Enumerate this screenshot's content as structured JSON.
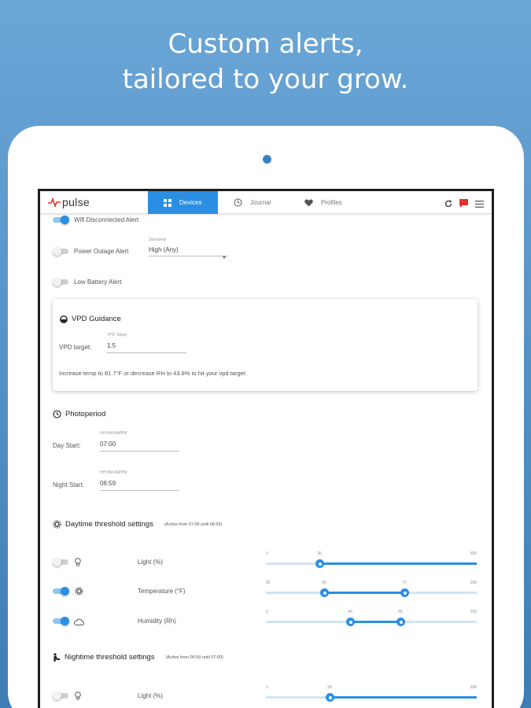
{
  "headline": {
    "line1": "Custom alerts,",
    "line2": "tailored to your grow."
  },
  "app": {
    "brand": "pulse",
    "tabs": [
      {
        "label": "Devices",
        "icon": "devices-grid-icon",
        "active": true
      },
      {
        "label": "Journal",
        "icon": "clock-icon",
        "active": false
      },
      {
        "label": "Profiles",
        "icon": "heart-icon",
        "active": false
      }
    ],
    "toolbar": {
      "refresh_icon": "refresh-icon",
      "alert_icon": "flag-alert-icon",
      "menu_icon": "hamburger-menu-icon"
    }
  },
  "alerts": {
    "wifi": {
      "label": "Wifi Disconnected Alert",
      "enabled": true
    },
    "power": {
      "label": "Power Outage Alert",
      "enabled": false,
      "sensitivity_label": "Sensitivity",
      "sensitivity_value": "High (Any)"
    },
    "battery": {
      "label": "Low Battery Alert",
      "enabled": false
    }
  },
  "vpd": {
    "title": "VPD Guidance",
    "target_label": "VPD target:",
    "field_label": "VPD Target",
    "value": "1.5",
    "guidance": "Increase temp to 81.7°F or decrease RH to 43.8% to hit your vpd target."
  },
  "photoperiod": {
    "title": "Photoperiod",
    "day_label": "Day Start:",
    "day_hint": "HH:MM AM/PM",
    "day_value": "07:00",
    "night_label": "Night Start:",
    "night_hint": "HH:MM AM/PM",
    "night_value": "06:59"
  },
  "daytime": {
    "title": "Daytime threshold settings",
    "note": "(Active from 07:00 until 06:59)",
    "rows": [
      {
        "label": "Light (%)",
        "icon": "lightbulb-icon",
        "enabled": false,
        "min": "1",
        "max": "100",
        "marks": [
          "35"
        ]
      },
      {
        "label": "Temperature (°F)",
        "icon": "sun-gear-icon",
        "enabled": true,
        "min": "32",
        "max": "100",
        "marks": [
          "50",
          "77"
        ]
      },
      {
        "label": "Humidity (Rh)",
        "icon": "cloud-icon",
        "enabled": true,
        "min": "1",
        "max": "100",
        "marks": [
          "40",
          "65"
        ]
      }
    ]
  },
  "nighttime": {
    "title": "Nightime threshold settings",
    "note": "(Active from 06:59 until 07:00)",
    "rows": [
      {
        "label": "Light (%)",
        "icon": "lightbulb-icon",
        "enabled": false,
        "min": "1",
        "max": "100",
        "marks": [
          "30"
        ]
      }
    ]
  },
  "colors": {
    "accent": "#2a8fe3",
    "background_top": "#6aa6d6",
    "background_bottom": "#3f7db5"
  }
}
